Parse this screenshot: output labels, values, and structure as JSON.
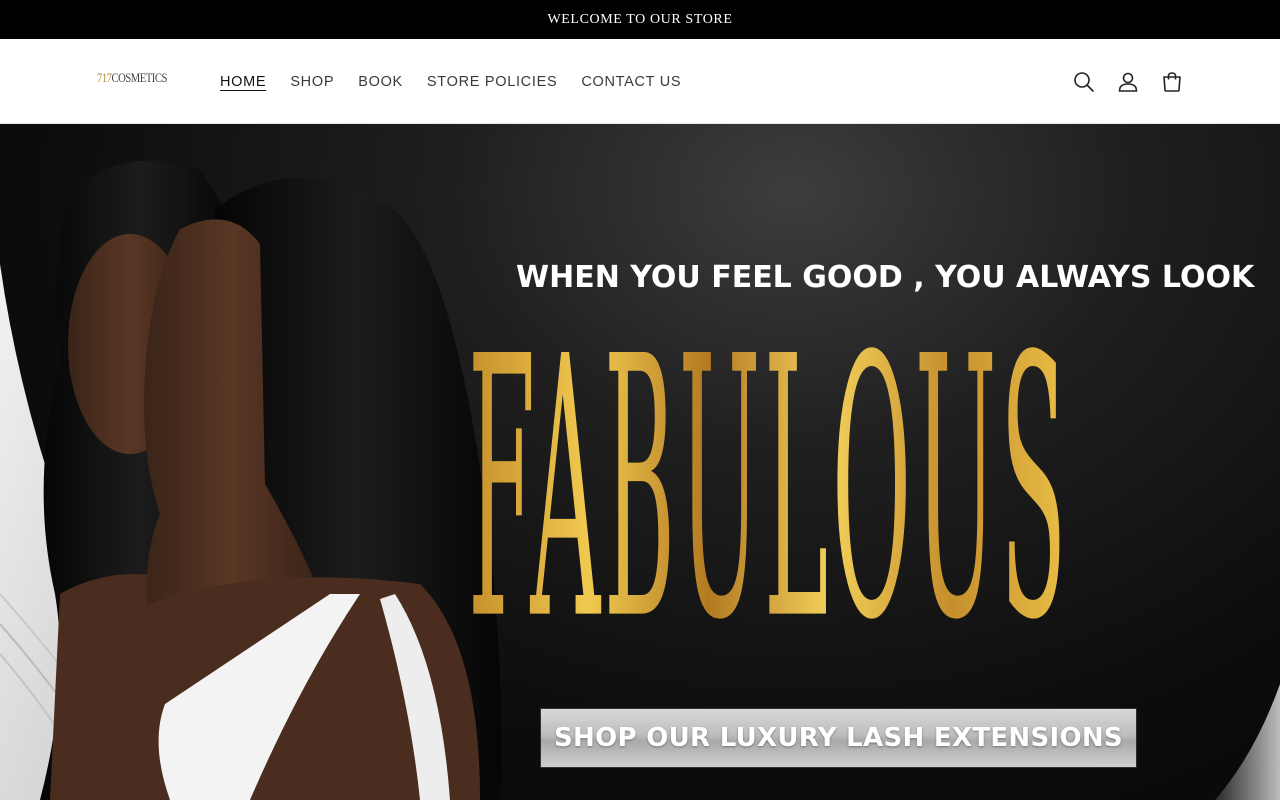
{
  "announcement": {
    "text": "WELCOME TO OUR STORE"
  },
  "header": {
    "logo": {
      "number": "717",
      "name": "COSMETICS"
    },
    "nav": [
      {
        "label": "HOME",
        "active": true
      },
      {
        "label": "SHOP"
      },
      {
        "label": "BOOK"
      },
      {
        "label": "STORE POLICIES"
      },
      {
        "label": "CONTACT US"
      }
    ],
    "icons": [
      "search-icon",
      "account-icon",
      "cart-icon"
    ]
  },
  "hero": {
    "tagline": "WHEN YOU FEEL GOOD , YOU ALWAYS LOOK",
    "headline": "FABULOUS",
    "cta": "SHOP OUR LUXURY LASH EXTENSIONS"
  },
  "colors": {
    "announcement_bg": "#000000",
    "gold": "#e0b445",
    "hero_bg": "#0d0d0d"
  }
}
